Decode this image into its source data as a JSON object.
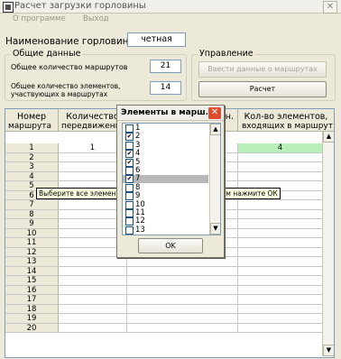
{
  "window": {
    "title": "Расчет загрузки горловины",
    "close_glyph": "✕"
  },
  "menu": [
    {
      "label": "О программе"
    },
    {
      "label": "Выход"
    }
  ],
  "neck": {
    "label": "Наименование горловины:",
    "value": "четная"
  },
  "general": {
    "title": "Общие данные",
    "routes_label": "Общее количество маршрутов",
    "routes_value": "21",
    "elements_label_1": "Общее количество элементов,",
    "elements_label_2": "участвующих в маршрутах",
    "elements_value": "14"
  },
  "control": {
    "title": "Управление",
    "enter_button": "Ввести данные о маршрутах",
    "calc_button": "Расчет"
  },
  "table": {
    "headers_top": [
      "Номер",
      "Количество",
      "н.",
      "Кол-во элементов,"
    ],
    "headers_bottom": [
      "маршрута",
      "передвижений",
      "",
      "входящих в маршрут"
    ],
    "rows": [
      {
        "n": "1",
        "moves": "1",
        "elems": "4"
      },
      {
        "n": "2",
        "moves": "",
        "elems": ""
      },
      {
        "n": "3",
        "moves": "",
        "elems": ""
      },
      {
        "n": "4",
        "moves": "",
        "elems": ""
      },
      {
        "n": "5",
        "moves": "",
        "elems": ""
      },
      {
        "n": "6",
        "moves": "",
        "elems": ""
      },
      {
        "n": "7",
        "moves": "",
        "elems": ""
      },
      {
        "n": "8",
        "moves": "",
        "elems": ""
      },
      {
        "n": "9",
        "moves": "",
        "elems": ""
      },
      {
        "n": "10",
        "moves": "",
        "elems": ""
      },
      {
        "n": "11",
        "moves": "",
        "elems": ""
      },
      {
        "n": "12",
        "moves": "",
        "elems": ""
      },
      {
        "n": "13",
        "moves": "",
        "elems": ""
      },
      {
        "n": "14",
        "moves": "",
        "elems": ""
      },
      {
        "n": "15",
        "moves": "",
        "elems": ""
      },
      {
        "n": "16",
        "moves": "",
        "elems": ""
      },
      {
        "n": "17",
        "moves": "",
        "elems": ""
      },
      {
        "n": "18",
        "moves": "",
        "elems": ""
      },
      {
        "n": "19",
        "moves": "",
        "elems": ""
      },
      {
        "n": "20",
        "moves": "",
        "elems": ""
      }
    ]
  },
  "dialog": {
    "title": "Элементы в марш...",
    "items": [
      {
        "label": "1",
        "checked": false
      },
      {
        "label": "2",
        "checked": true
      },
      {
        "label": "3",
        "checked": false
      },
      {
        "label": "4",
        "checked": true
      },
      {
        "label": "5",
        "checked": true
      },
      {
        "label": "6",
        "checked": false
      },
      {
        "label": "7",
        "checked": true
      },
      {
        "label": "8",
        "checked": false
      },
      {
        "label": "9",
        "checked": false
      },
      {
        "label": "10",
        "checked": false
      },
      {
        "label": "11",
        "checked": false
      },
      {
        "label": "12",
        "checked": false
      },
      {
        "label": "13",
        "checked": false
      }
    ],
    "ok": "OK"
  },
  "tooltip": "Выберите все элементы, входящие в маршрут, затем нажмите ОК",
  "colors": {
    "highlight_cell": "#b9f0b9",
    "selected_item": "#b8b8b8"
  }
}
